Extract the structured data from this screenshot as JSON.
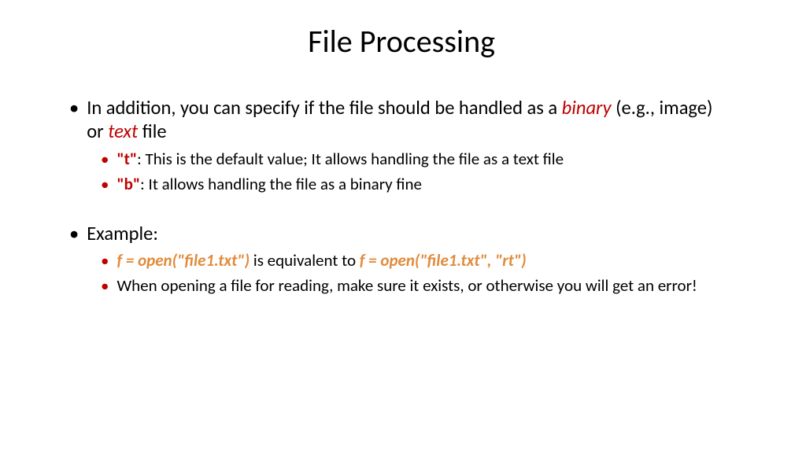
{
  "title": "File Processing",
  "b1": {
    "pre": "In addition, you can specify if the file should be handled as a ",
    "binary": "binary",
    "mid": " (e.g., image) or ",
    "text": "text",
    "post": " file"
  },
  "b1a": {
    "code": "\"t\"",
    "desc": ": This is the default value; It allows handling the file as a text file"
  },
  "b1b": {
    "code": "\"b\"",
    "desc": ": It allows handling the file as a binary fine"
  },
  "b2": {
    "label": "Example:"
  },
  "b2a": {
    "left": "f = open(\"file1.txt\")",
    "mid": " is equivalent to ",
    "right": "f = open(\"file1.txt\", \"rt\")"
  },
  "b2b": {
    "text": "When opening a file for reading, make sure it exists, or otherwise you will get an error!"
  }
}
